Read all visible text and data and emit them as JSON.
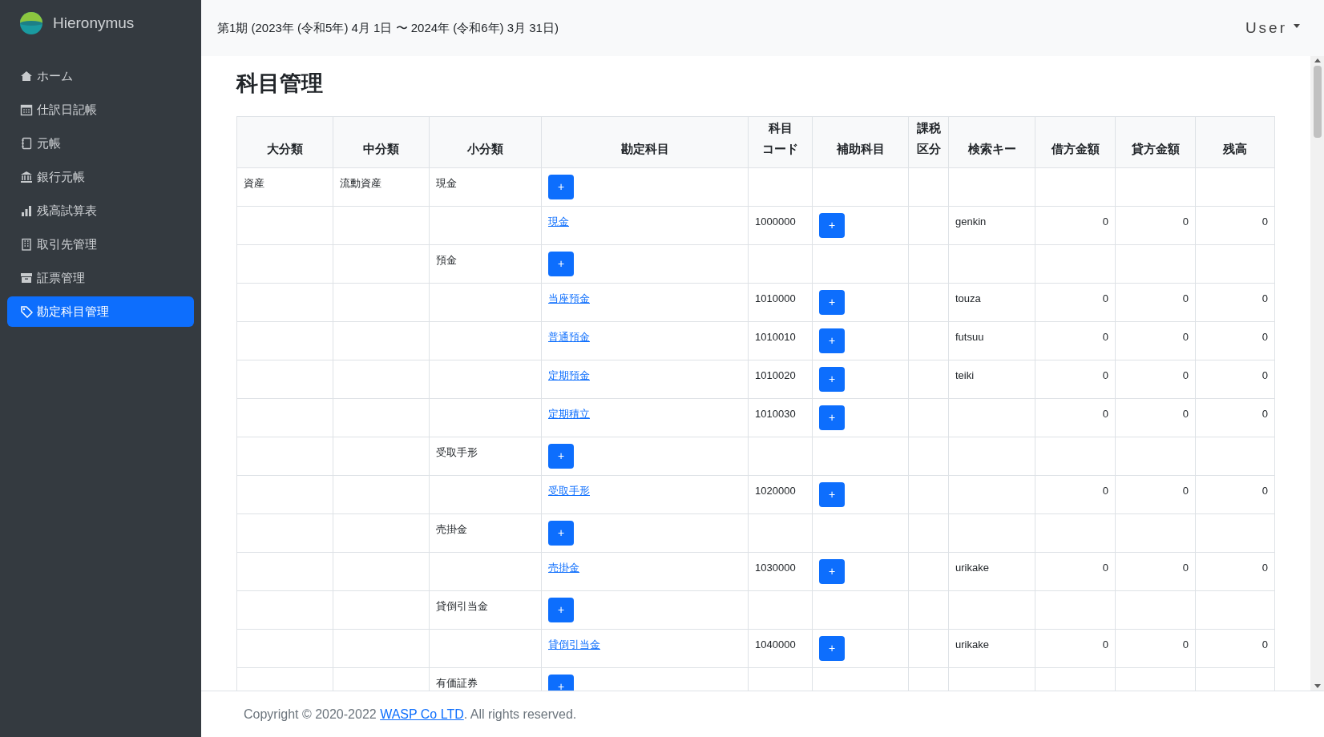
{
  "brand": {
    "name": "Hieronymus"
  },
  "sidebar": {
    "items": [
      {
        "label": "ホーム",
        "selected": false
      },
      {
        "label": "仕訳日記帳",
        "selected": false
      },
      {
        "label": "元帳",
        "selected": false
      },
      {
        "label": "銀行元帳",
        "selected": false
      },
      {
        "label": "残高試算表",
        "selected": false
      },
      {
        "label": "取引先管理",
        "selected": false
      },
      {
        "label": "証票管理",
        "selected": false
      },
      {
        "label": "勘定科目管理",
        "selected": true
      }
    ]
  },
  "header": {
    "period": "第1期 (2023年 (令和5年) 4月 1日 〜 2024年 (令和6年) 3月 31日)",
    "user_menu": "User"
  },
  "page_title": "科目管理",
  "table": {
    "columns": [
      "大分類",
      "中分類",
      "小分類",
      "勘定科目",
      "科目コード",
      "補助科目",
      "課税区分",
      "検索キー",
      "借方金額",
      "貸方金額",
      "残高"
    ],
    "add_button_label": "+",
    "rows": [
      {
        "kind": "category",
        "major": "資産",
        "middle": "流動資産",
        "minor": "現金"
      },
      {
        "kind": "account",
        "account": "現金",
        "code": "1000000",
        "search_key": "genkin",
        "debit": "0",
        "credit": "0",
        "balance": "0"
      },
      {
        "kind": "category",
        "minor": "預金"
      },
      {
        "kind": "account",
        "account": "当座預金",
        "code": "1010000",
        "search_key": "touza",
        "debit": "0",
        "credit": "0",
        "balance": "0"
      },
      {
        "kind": "account",
        "account": "普通預金",
        "code": "1010010",
        "search_key": "futsuu",
        "debit": "0",
        "credit": "0",
        "balance": "0"
      },
      {
        "kind": "account",
        "account": "定期預金",
        "code": "1010020",
        "search_key": "teiki",
        "debit": "0",
        "credit": "0",
        "balance": "0"
      },
      {
        "kind": "account",
        "account": "定期積立",
        "code": "1010030",
        "debit": "0",
        "credit": "0",
        "balance": "0"
      },
      {
        "kind": "category",
        "minor": "受取手形"
      },
      {
        "kind": "account",
        "account": "受取手形",
        "code": "1020000",
        "debit": "0",
        "credit": "0",
        "balance": "0"
      },
      {
        "kind": "category",
        "minor": "売掛金"
      },
      {
        "kind": "account",
        "account": "売掛金",
        "code": "1030000",
        "search_key": "urikake",
        "debit": "0",
        "credit": "0",
        "balance": "0"
      },
      {
        "kind": "category",
        "minor": "貸倒引当金"
      },
      {
        "kind": "account",
        "account": "貸倒引当金",
        "code": "1040000",
        "search_key": "urikake",
        "debit": "0",
        "credit": "0",
        "balance": "0"
      },
      {
        "kind": "category",
        "minor": "有価証券"
      }
    ]
  },
  "footer": {
    "prefix": "Copyright © 2020-2022 ",
    "link": "WASP Co LTD",
    "suffix": ". All rights reserved."
  }
}
